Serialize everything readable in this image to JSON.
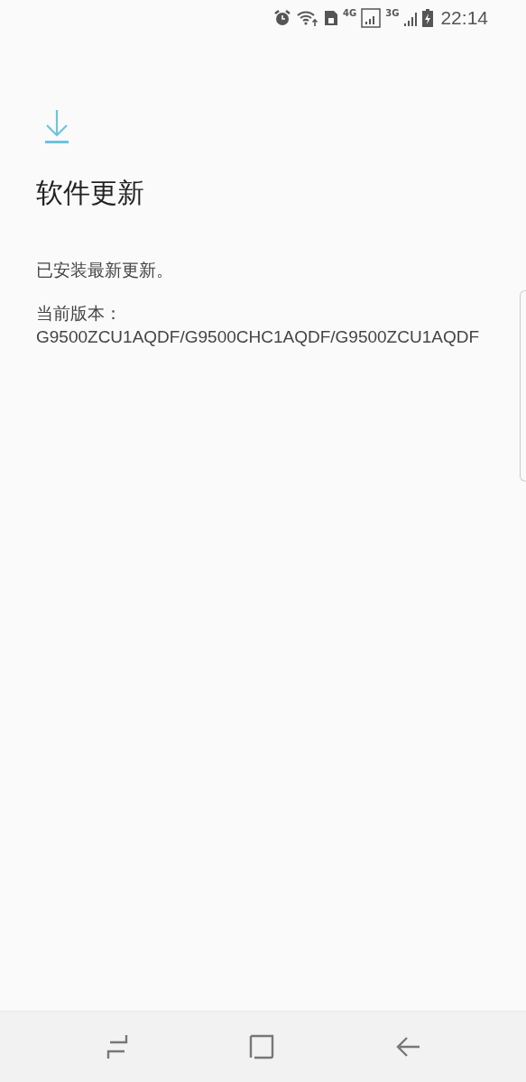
{
  "status_bar": {
    "network_4g": "4G",
    "network_3g": "3G",
    "time": "22:14"
  },
  "page": {
    "title": "软件更新",
    "message": "已安装最新更新。",
    "version": "当前版本：G9500ZCU1AQDF/G9500CHC1AQDF/G9500ZCU1AQDF"
  }
}
